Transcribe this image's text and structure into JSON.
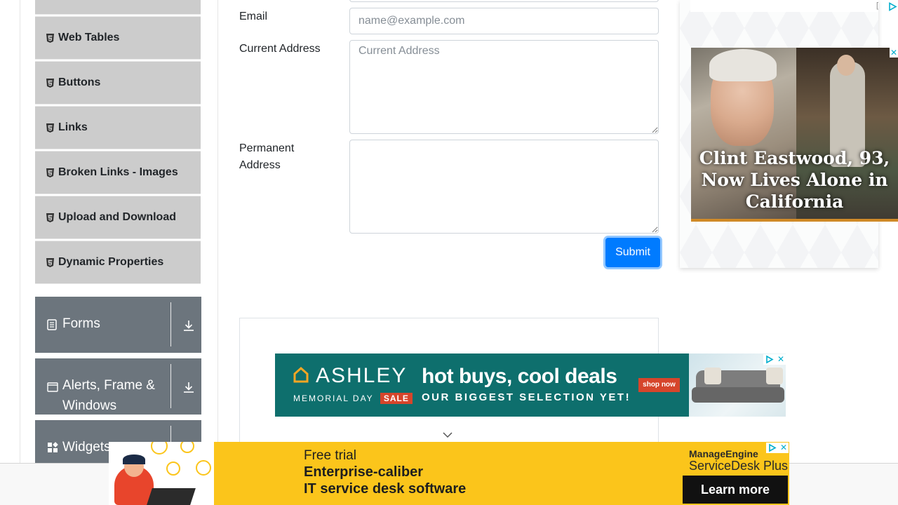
{
  "sidebar": {
    "elements_items": [
      {
        "label": "Web Tables"
      },
      {
        "label": "Buttons"
      },
      {
        "label": "Links"
      },
      {
        "label": "Broken Links - Images"
      },
      {
        "label": "Upload and Download"
      },
      {
        "label": "Dynamic Properties"
      }
    ],
    "groups": [
      {
        "label": "Forms",
        "icon": "form-icon"
      },
      {
        "label": "Alerts, Frame &",
        "label_line2": "Windows",
        "icon": "window-icon"
      },
      {
        "label": "Widgets",
        "icon": "widgets-icon"
      }
    ]
  },
  "form": {
    "email_label": "Email",
    "email_placeholder": "name@example.com",
    "current_address_label": "Current Address",
    "current_address_placeholder": "Current Address",
    "permanent_address_label_line1": "Permanent",
    "permanent_address_label_line2": "Address",
    "submit_label": "Submit"
  },
  "right_ad": {
    "marker": "[?]",
    "caption": "Clint Eastwood, 93, Now Lives Alone in California",
    "close": "✕"
  },
  "ashley_ad": {
    "brand": "ASHLEY",
    "sub_prefix": "MEMORIAL DAY",
    "sub_badge": "SALE",
    "headline": "hot buys, cool deals",
    "tagline": "OUR BIGGEST SELECTION YET!",
    "cta": "shop now",
    "close": "✕"
  },
  "bottom_ad": {
    "free": "Free trial",
    "line1": "Enterprise-caliber",
    "line2": "IT service desk software",
    "brand1": "ManageEngine",
    "brand2": "ServiceDesk Plus",
    "cta": "Learn more",
    "close": "✕"
  },
  "colors": {
    "sidebar_item_bg": "#cccccc",
    "group_header_bg": "#6c757d",
    "primary": "#007bff",
    "ashley_teal": "#0e6f6d",
    "ashley_red": "#d6452b",
    "bottom_ad_yellow": "#fbc51b"
  }
}
